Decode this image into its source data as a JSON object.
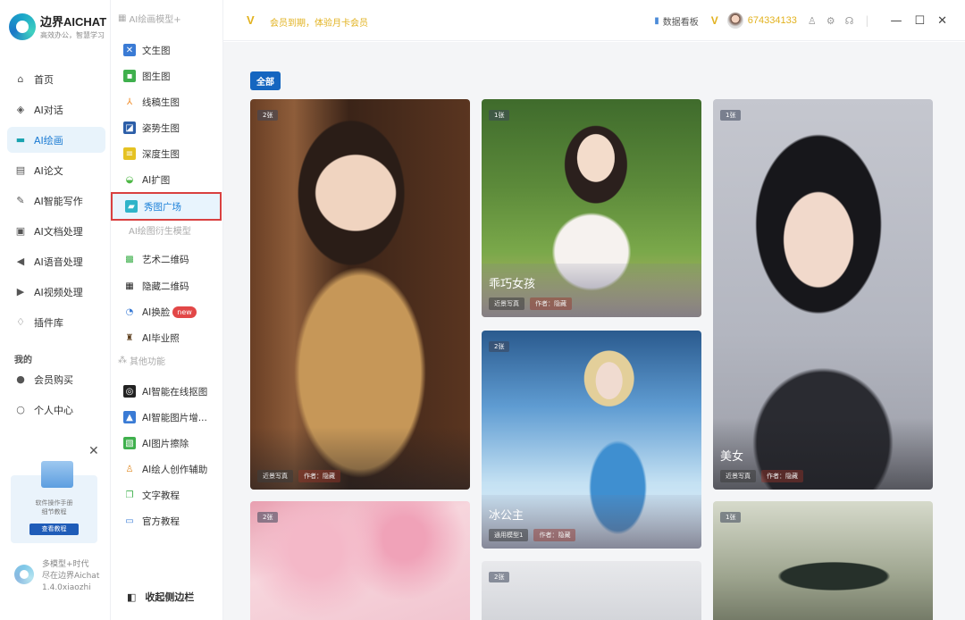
{
  "app": {
    "title": "边界AICHAT",
    "subtitle": "高效办公，智慧学习",
    "footer_line1": "多模型+时代",
    "footer_line2": "尽在边界Aichat",
    "footer_version": "1.4.0xiaozhi"
  },
  "sidebar": {
    "items": [
      {
        "label": "首页",
        "icon": "home-icon"
      },
      {
        "label": "AI对话",
        "icon": "cube-icon"
      },
      {
        "label": "AI绘画",
        "icon": "palette-icon"
      },
      {
        "label": "AI论文",
        "icon": "document-icon"
      },
      {
        "label": "AI智能写作",
        "icon": "pen-icon"
      },
      {
        "label": "AI文档处理",
        "icon": "doc-process-icon"
      },
      {
        "label": "AI语音处理",
        "icon": "speaker-icon"
      },
      {
        "label": "AI视频处理",
        "icon": "play-icon"
      },
      {
        "label": "插件库",
        "icon": "bulb-icon"
      }
    ],
    "section_mine": "我的",
    "mine_items": [
      {
        "label": "会员购买",
        "icon": "user-icon"
      },
      {
        "label": "个人中心",
        "icon": "person-icon"
      }
    ]
  },
  "promo": {
    "line1": "软件操作手册",
    "line2": "细节教程",
    "button": "查看教程"
  },
  "subnav": {
    "header_models": "AI绘画模型+",
    "model_items": [
      {
        "label": "文生图",
        "icon": "text-image-icon",
        "color": "#3a7bd5"
      },
      {
        "label": "图生图",
        "icon": "image-image-icon",
        "color": "#3fb04d"
      },
      {
        "label": "线稿生图",
        "icon": "lineart-icon",
        "color": "#f08a24"
      },
      {
        "label": "姿势生图",
        "icon": "pose-icon",
        "color": "#2c5ea8"
      },
      {
        "label": "深度生图",
        "icon": "depth-icon",
        "color": "#e5c222"
      },
      {
        "label": "AI扩图",
        "icon": "expand-icon",
        "color": "#4fb847"
      },
      {
        "label": "秀图广场",
        "icon": "gallery-icon",
        "color": "#2fb4c9"
      }
    ],
    "header_derived": "AI绘图衍生模型",
    "derived_items": [
      {
        "label": "艺术二维码",
        "icon": "art-qr-icon",
        "color": "#3fb04d"
      },
      {
        "label": "隐藏二维码",
        "icon": "hidden-qr-icon",
        "color": "#222222"
      },
      {
        "label": "AI换脸",
        "icon": "face-swap-icon",
        "color": "#3a7bd5",
        "badge": "new"
      },
      {
        "label": "AI毕业照",
        "icon": "graduation-icon",
        "color": "#5b3c1a"
      }
    ],
    "header_other": "其他功能",
    "other_items": [
      {
        "label": "AI智能在线抠图",
        "icon": "cutout-icon",
        "color": "#222222"
      },
      {
        "label": "AI智能图片增...",
        "icon": "enhance-icon",
        "color": "#3a7bd5"
      },
      {
        "label": "AI图片擦除",
        "icon": "erase-icon",
        "color": "#3fb04d"
      },
      {
        "label": "AI绘人创作辅助",
        "icon": "portrait-icon",
        "color": "#e08a24"
      },
      {
        "label": "文字教程",
        "icon": "book-icon",
        "color": "#3fb04d"
      },
      {
        "label": "官方教程",
        "icon": "monitor-icon",
        "color": "#3a7bd5"
      }
    ],
    "collapse_label": "收起侧边栏"
  },
  "topbar": {
    "vip_logo": "V",
    "vip_text": "会员到期，体验月卡会员",
    "board_label": "数据看板",
    "user_id": "674334133"
  },
  "main": {
    "filter_all": "全部",
    "cards": [
      {
        "count": "2张",
        "title": "",
        "tags": [
          "近景写真",
          "作者：隐藏"
        ]
      },
      {
        "count": "1张",
        "title": "乖巧女孩",
        "tags": [
          "近景写真",
          "作者：隐藏"
        ]
      },
      {
        "count": "1张",
        "title": "美女",
        "tags": [
          "近景写真",
          "作者：隐藏"
        ]
      },
      {
        "count": "2张",
        "title": "冰公主",
        "tags": [
          "通用模型1",
          "作者：隐藏"
        ]
      },
      {
        "count": "2张",
        "title": "",
        "tags": []
      },
      {
        "count": "2张",
        "title": "",
        "tags": []
      },
      {
        "count": "1张",
        "title": "",
        "tags": []
      }
    ]
  }
}
